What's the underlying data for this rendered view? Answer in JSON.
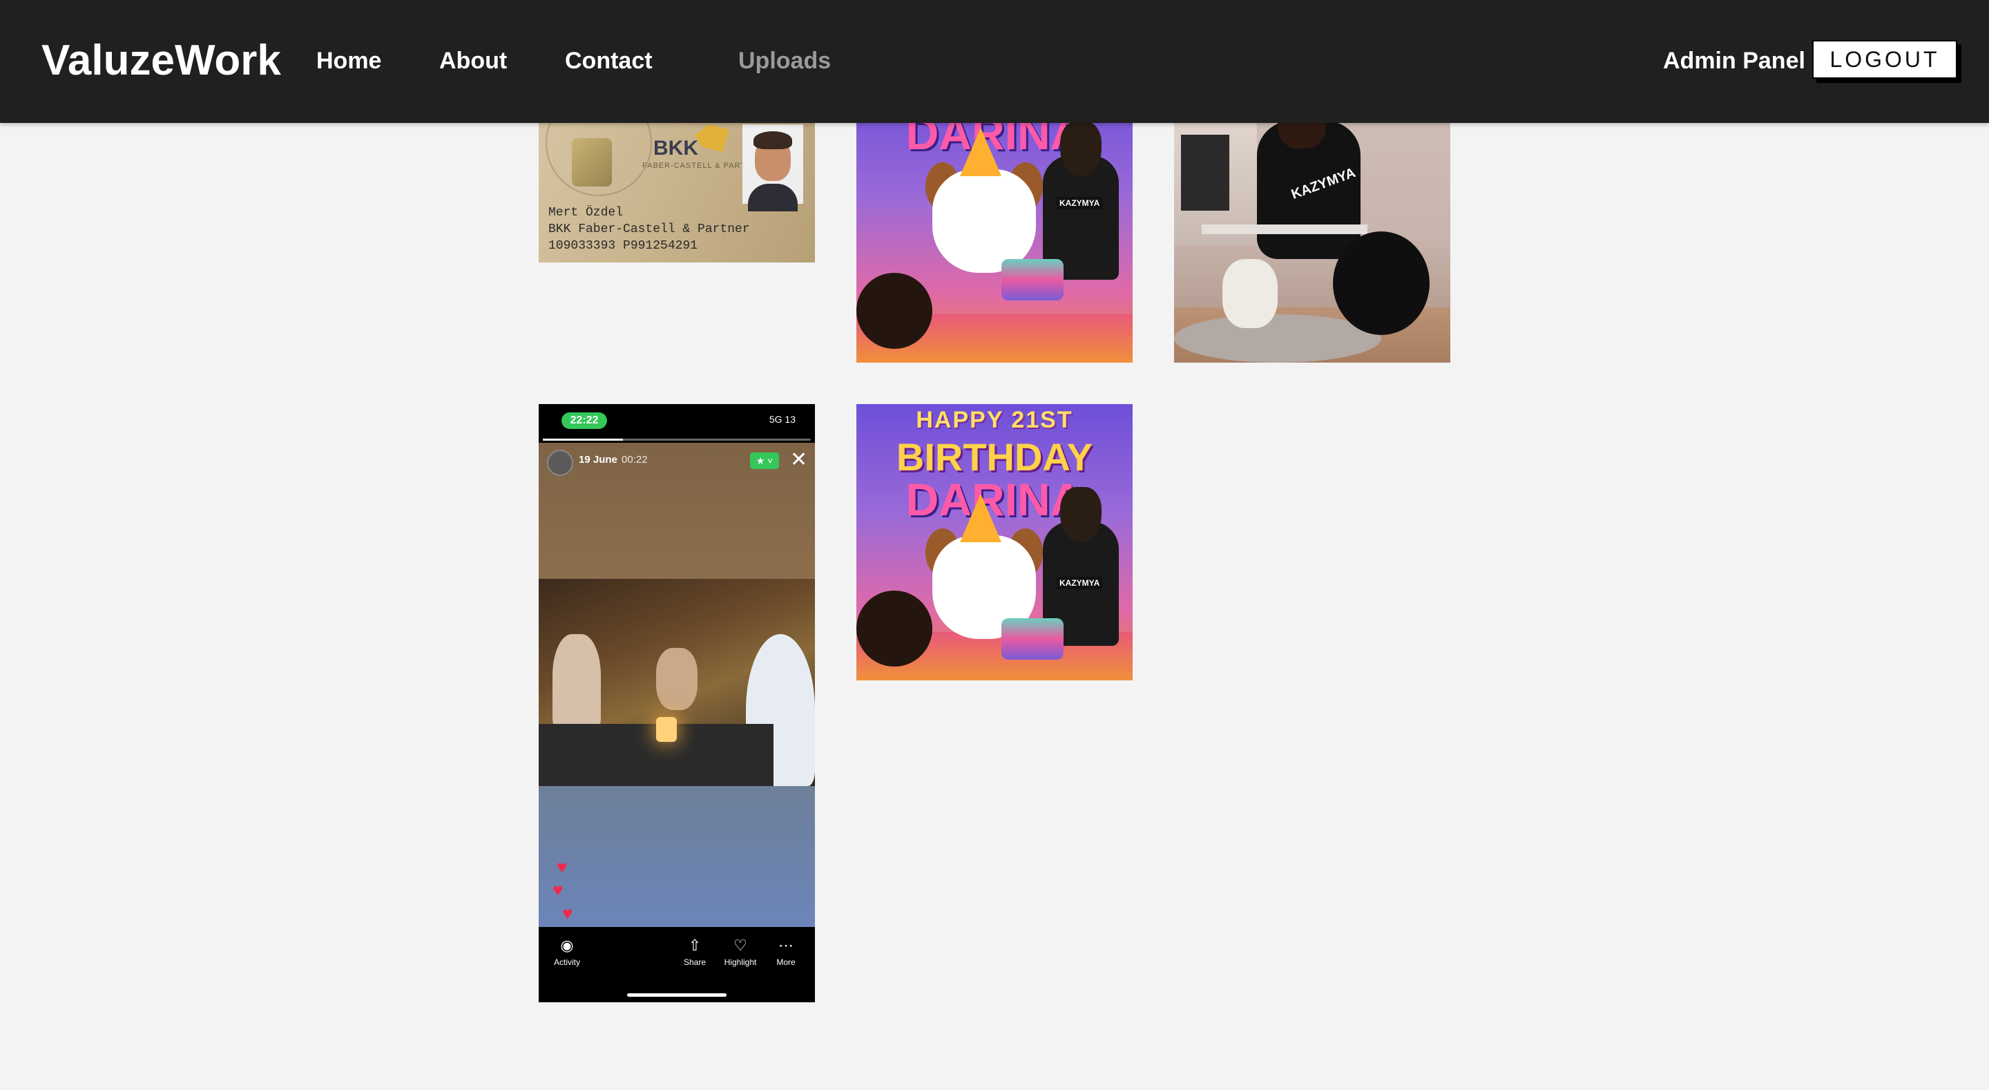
{
  "nav": {
    "brand": "ValuzeWork",
    "links": {
      "home": "Home",
      "about": "About",
      "contact": "Contact",
      "uploads": "Uploads"
    },
    "admin": "Admin Panel",
    "logout": "LOGOUT"
  },
  "gallery": {
    "id_card": {
      "title": "BKK",
      "subtitle": "FABER-CASTELL & PARTNER",
      "name": "Mert Özdel",
      "insurer": "BKK Faber-Castell & Partner",
      "numbers": "109033393    P991254291"
    },
    "birthday": {
      "line1": "HAPPY 21ST",
      "line2": "BIRTHDAY",
      "line3": "DARINA",
      "shirt": "KAZYMYA"
    },
    "room": {
      "shirt": "KAZYMYA"
    },
    "story": {
      "time": "22:22",
      "network": "5G 13",
      "date": "19 June",
      "hour": "00:22",
      "tools": {
        "activity": "Activity",
        "share": "Share",
        "highlight": "Highlight",
        "more": "More"
      }
    }
  },
  "colors": {
    "topbar": "#202020",
    "page": "#f3f3f3",
    "uploads_link": "#9a9a9a"
  }
}
